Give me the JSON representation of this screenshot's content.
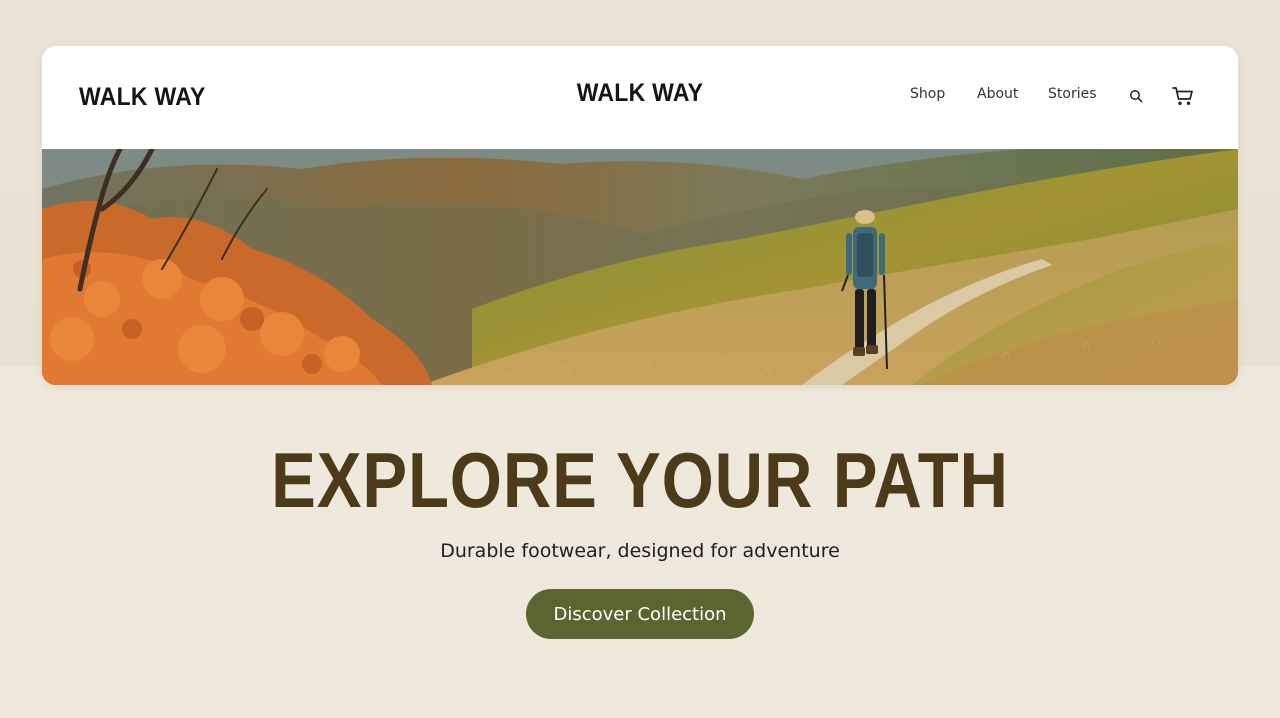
{
  "brand": {
    "logo_left": "WALK WAY",
    "logo_center": "WALK WAY"
  },
  "nav": {
    "links": [
      {
        "label": "Shop"
      },
      {
        "label": "About"
      },
      {
        "label": "Stories"
      }
    ],
    "icons": {
      "search": "search-icon",
      "cart": "cart-icon"
    }
  },
  "hero": {
    "image_subject": "hiker-on-mountain-trail"
  },
  "main": {
    "headline": "EXPLORE YOUR PATH",
    "subtitle": "Durable footwear, designed for adventure",
    "cta_label": "Discover Collection"
  },
  "colors": {
    "background": "#efe8dc",
    "headline": "#4d3a18",
    "cta_background": "#5a6530",
    "cta_text": "#ffffff"
  }
}
